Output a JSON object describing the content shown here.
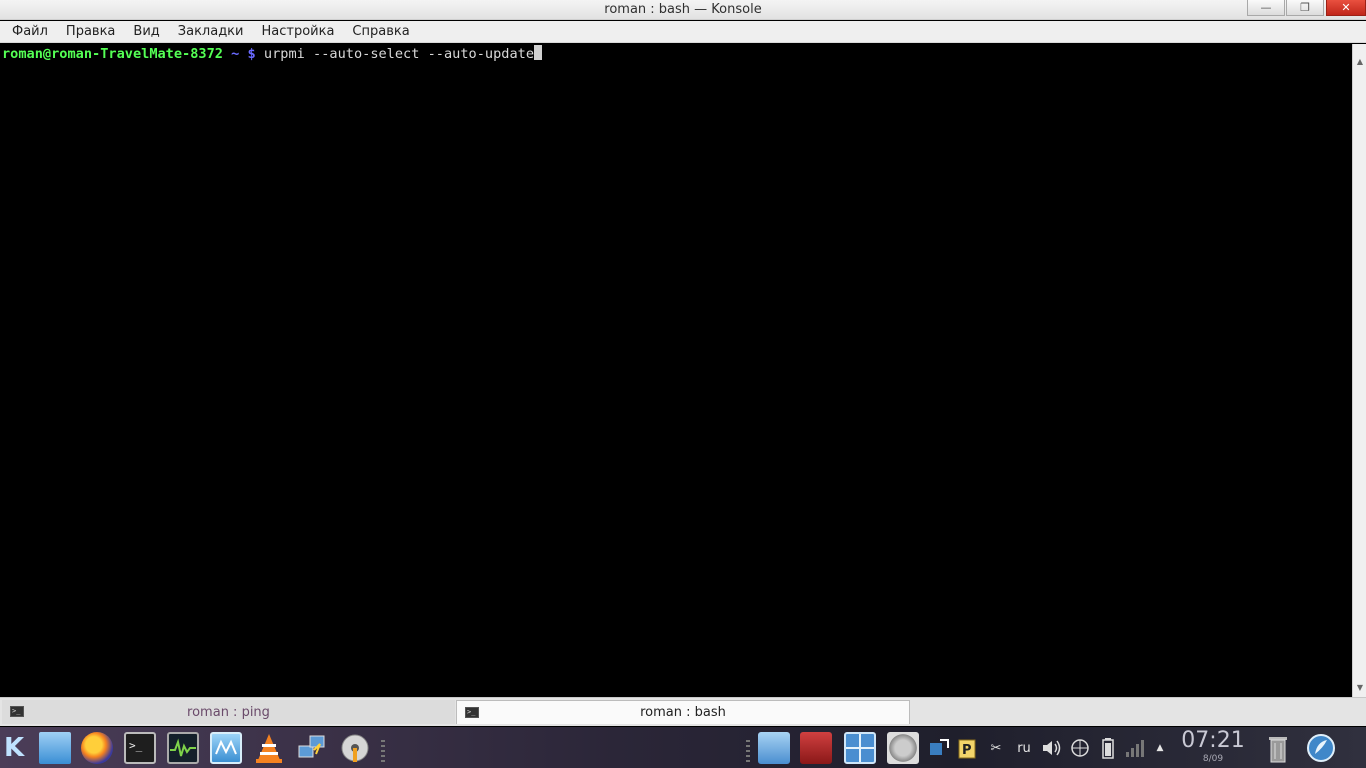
{
  "window": {
    "title": "roman : bash — Konsole",
    "minimize_glyph": "—",
    "maximize_glyph": "❐",
    "close_glyph": "✕"
  },
  "menu": [
    "Файл",
    "Правка",
    "Вид",
    "Закладки",
    "Настройка",
    "Справка"
  ],
  "terminal": {
    "user_host": "roman@roman-TravelMate-8372",
    "path": "~ $",
    "command": "urpmi --auto-select --auto-update"
  },
  "tabs": [
    {
      "label": "roman : ping",
      "active": false
    },
    {
      "label": "roman : bash",
      "active": true
    }
  ],
  "panel": {
    "kmenu_glyph": "K",
    "launchers": [
      "file-manager-icon",
      "firefox-icon",
      "terminal-icon",
      "system-monitor-icon",
      "ksysguard-icon",
      "vlc-icon",
      "network-tool-icon",
      "disc-burner-icon"
    ],
    "tray_icons": [
      "screenshot-icon",
      "package-manager-icon",
      "window-switcher-icon",
      "settings-tool-icon",
      "updates-icon",
      "clipboard-icon",
      "scissors-icon"
    ],
    "keyboard_layout": "ru",
    "clock_time": "07:21",
    "clock_date": "8/09"
  },
  "colors": {
    "prompt_user": "#54ff54",
    "prompt_path": "#6a6aff",
    "close_button": "#d43a2c"
  }
}
